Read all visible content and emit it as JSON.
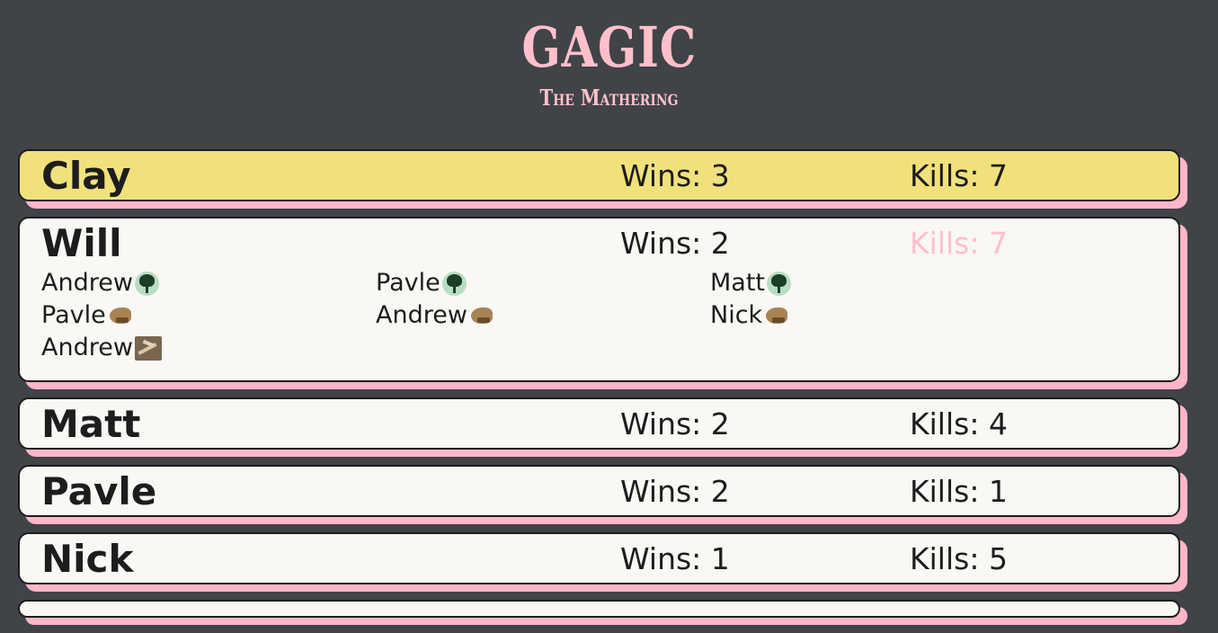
{
  "header": {
    "title": "GAGIC",
    "subtitle": "The Mathering"
  },
  "players": [
    {
      "name": "Clay",
      "wins": "Wins: 3",
      "kills": "Kills: 7"
    },
    {
      "name": "Will",
      "wins": "Wins: 2",
      "kills": "Kills: 7",
      "victims": [
        {
          "name": "Andrew",
          "deck_icon": "forest-icon"
        },
        {
          "name": "Pavle",
          "deck_icon": "forest-icon"
        },
        {
          "name": "Matt",
          "deck_icon": "forest-icon"
        },
        {
          "name": "Pavle",
          "deck_icon": "dinosaur-icon"
        },
        {
          "name": "Andrew",
          "deck_icon": "dinosaur-icon"
        },
        {
          "name": "Nick",
          "deck_icon": "dinosaur-icon"
        },
        {
          "name": "Andrew",
          "deck_icon": "fossil-icon"
        }
      ]
    },
    {
      "name": "Matt",
      "wins": "Wins: 2",
      "kills": "Kills: 4"
    },
    {
      "name": "Pavle",
      "wins": "Wins: 2",
      "kills": "Kills: 1"
    },
    {
      "name": "Nick",
      "wins": "Wins: 1",
      "kills": "Kills: 5"
    }
  ],
  "colors": {
    "background": "#404348",
    "accent_pink": "#ffc0cb",
    "leader_yellow": "#f0e17b",
    "card_white": "#faf8f5"
  }
}
